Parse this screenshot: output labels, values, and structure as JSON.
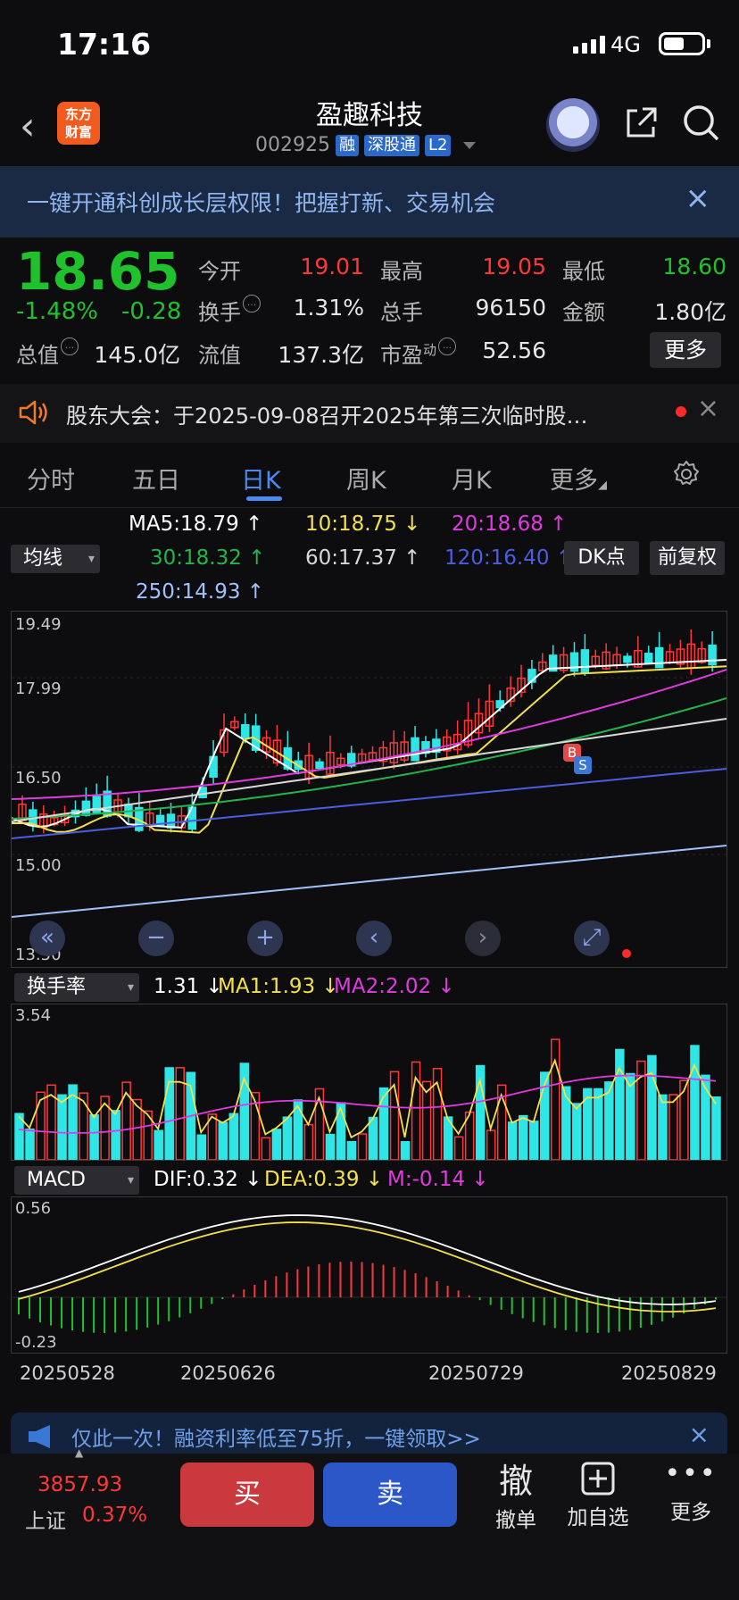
{
  "status_bar": {
    "time": "17:16",
    "network": "4G"
  },
  "header": {
    "logo_text": "东方财富",
    "stock_name": "盈趣科技",
    "stock_code": "002925",
    "tags": [
      "融",
      "深股通",
      "L2"
    ]
  },
  "banner": {
    "text": "一键开通科创成长层权限！把握打新、交易机会",
    "close_label": "×"
  },
  "quote": {
    "price": "18.65",
    "change_pct": "-1.48%",
    "change_abs": "-0.28",
    "rows": [
      [
        {
          "label": "今开",
          "value": "19.01",
          "color": "red"
        },
        {
          "label": "最高",
          "value": "19.05",
          "color": "red"
        },
        {
          "label": "最低",
          "value": "18.60",
          "color": "green"
        }
      ],
      [
        {
          "label": "换手",
          "value": "1.31%",
          "color": "white"
        },
        {
          "label": "总手",
          "value": "96150",
          "color": "white"
        },
        {
          "label": "金额",
          "value": "1.80亿",
          "color": "white"
        }
      ]
    ],
    "total_value_label": "总值",
    "total_value": "145.0亿",
    "float_label": "流值",
    "float_value": "137.3亿",
    "pe_label": "市盈",
    "pe_superscript": "动",
    "pe_value": "52.56",
    "more_label": "更多"
  },
  "notice": {
    "text": "股东大会：于2025-09-08召开2025年第三次临时股…",
    "close_label": "×"
  },
  "tabs": [
    {
      "label": "分时",
      "active": false
    },
    {
      "label": "五日",
      "active": false
    },
    {
      "label": "日K",
      "active": true
    },
    {
      "label": "周K",
      "active": false
    },
    {
      "label": "月K",
      "active": false
    },
    {
      "label": "更多",
      "active": false
    }
  ],
  "ma_panel": {
    "selector": "均线",
    "items": [
      {
        "text": "MA5:18.79 ↑",
        "color": "#ffffff"
      },
      {
        "text": "10:18.75 ↓",
        "color": "#f3e04a"
      },
      {
        "text": "20:18.68 ↑",
        "color": "#e03ae0"
      },
      {
        "text": "30:18.32 ↑",
        "color": "#22b64a"
      },
      {
        "text": "60:17.37 ↑",
        "color": "#d8d8d8"
      },
      {
        "text": "120:16.40 ↑",
        "color": "#4b5ee0"
      },
      {
        "text": "250:14.93 ↑",
        "color": "#9fc2ff"
      }
    ],
    "dk_label": "DK点",
    "fq_label": "前复权"
  },
  "kline": {
    "y_labels": [
      "19.49",
      "17.99",
      "16.50",
      "15.00",
      "13.50"
    ],
    "marker_b": "B",
    "marker_s": "S"
  },
  "turnover": {
    "selector": "换手率",
    "items": [
      {
        "text": "1.31 ↓",
        "color": "#ffffff"
      },
      {
        "text": "MA1:1.93 ↓",
        "color": "#f3e04a"
      },
      {
        "text": "MA2:2.02 ↓",
        "color": "#e03ae0"
      }
    ],
    "max_label": "3.54"
  },
  "macd": {
    "selector": "MACD",
    "items": [
      {
        "text": "DIF:0.32 ↓",
        "color": "#ffffff"
      },
      {
        "text": "DEA:0.39 ↓",
        "color": "#f3e04a"
      },
      {
        "text": "M:-0.14 ↓",
        "color": "#e03ae0"
      }
    ],
    "top_label": "0.56",
    "bottom_label": "-0.23"
  },
  "dates": [
    "20250528",
    "20250626",
    "20250729",
    "20250829"
  ],
  "promo": {
    "text": "仅此一次！融资利率低至75折，一键领取>>",
    "close_label": "×"
  },
  "bottom_bar": {
    "index_value": "3857.93",
    "index_name": "上证",
    "index_change": "0.37%",
    "buy_label": "买",
    "sell_label": "卖",
    "cancel_icon_char": "撤",
    "cancel_label": "撤单",
    "watchlist_label": "加自选",
    "more_label": "更多"
  },
  "colors": {
    "up": "#ff3737",
    "down": "#1fc22c",
    "accent": "#4a8bf0",
    "bar_down": "#2ee6e6"
  }
}
